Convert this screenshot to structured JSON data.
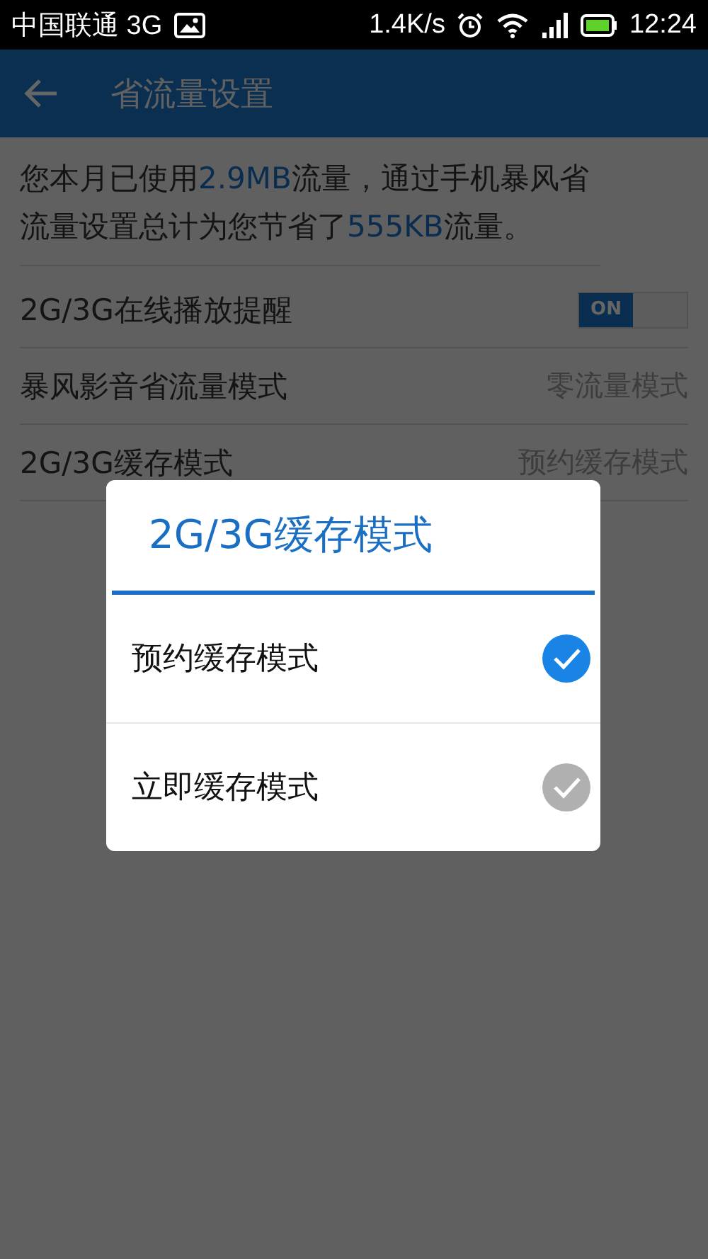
{
  "status_bar": {
    "carrier": "中国联通 3G",
    "speed": "1.4K/s",
    "time": "12:24"
  },
  "header": {
    "title": "省流量设置"
  },
  "summary": [
    {
      "text": "您本月已使用",
      "highlight": false
    },
    {
      "text": "2.9MB",
      "highlight": true
    },
    {
      "text": "流量，通过手机暴风省流量设置总计为您节省了",
      "highlight": false
    },
    {
      "text": "555KB",
      "highlight": true
    },
    {
      "text": "流量。",
      "highlight": false
    }
  ],
  "settings": [
    {
      "kind": "toggle",
      "label": "2G/3G在线播放提醒",
      "on": true,
      "on_label": "ON"
    },
    {
      "kind": "value",
      "label": "暴风影音省流量模式",
      "value": "零流量模式"
    },
    {
      "kind": "value",
      "label": "2G/3G缓存模式",
      "value": "预约缓存模式"
    }
  ],
  "dialog": {
    "title": "2G/3G缓存模式",
    "options": [
      {
        "label": "预约缓存模式",
        "selected": true
      },
      {
        "label": "立即缓存模式",
        "selected": false
      }
    ]
  }
}
